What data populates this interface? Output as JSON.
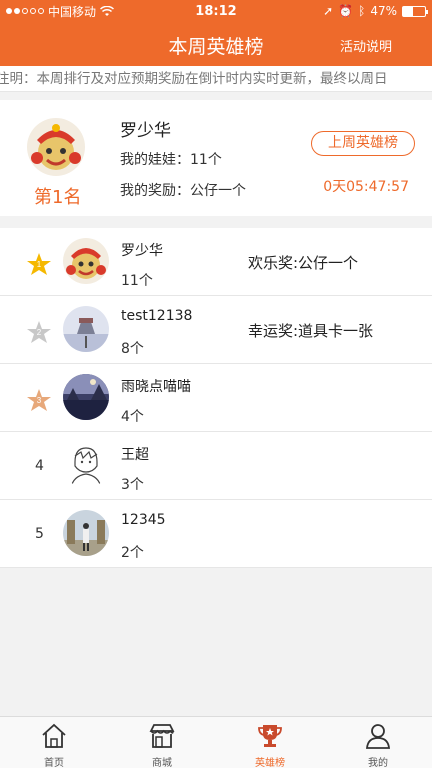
{
  "statusbar": {
    "carrier": "中国移动",
    "time": "18:12",
    "battery": "47%",
    "battery_level": 0.47
  },
  "header": {
    "title": "本周英雄榜",
    "action": "活动说明"
  },
  "notice": "注明：本周排行及对应预期奖励在倒计时内实时更新，最终以周日",
  "champion": {
    "rank": "第1名",
    "name": "罗少华",
    "dolls": "我的娃娃：11个",
    "reward": "我的奖励：公仔一个",
    "last_week_button": "上周英雄榜",
    "countdown": "0天05:47:57"
  },
  "rankings": [
    {
      "rank": "1",
      "name": "罗少华",
      "count": "11个",
      "prize": "欢乐奖:公仔一个"
    },
    {
      "rank": "2",
      "name": "test12138",
      "count": "8个",
      "prize": "幸运奖:道具卡一张"
    },
    {
      "rank": "3",
      "name": "雨晓点喵喵",
      "count": "4个",
      "prize": ""
    },
    {
      "rank": "4",
      "name": "王超",
      "count": "3个",
      "prize": ""
    },
    {
      "rank": "5",
      "name": "12345",
      "count": "2个",
      "prize": ""
    }
  ],
  "tabs": [
    {
      "label": "首页",
      "icon": "home-icon"
    },
    {
      "label": "商城",
      "icon": "shop-icon"
    },
    {
      "label": "英雄榜",
      "icon": "trophy-icon"
    },
    {
      "label": "我的",
      "icon": "user-icon"
    }
  ],
  "colors": {
    "accent": "#ee6a2b",
    "gold": "#f5b800",
    "silver": "#c8c8c8",
    "bronze": "#e7a87a"
  }
}
